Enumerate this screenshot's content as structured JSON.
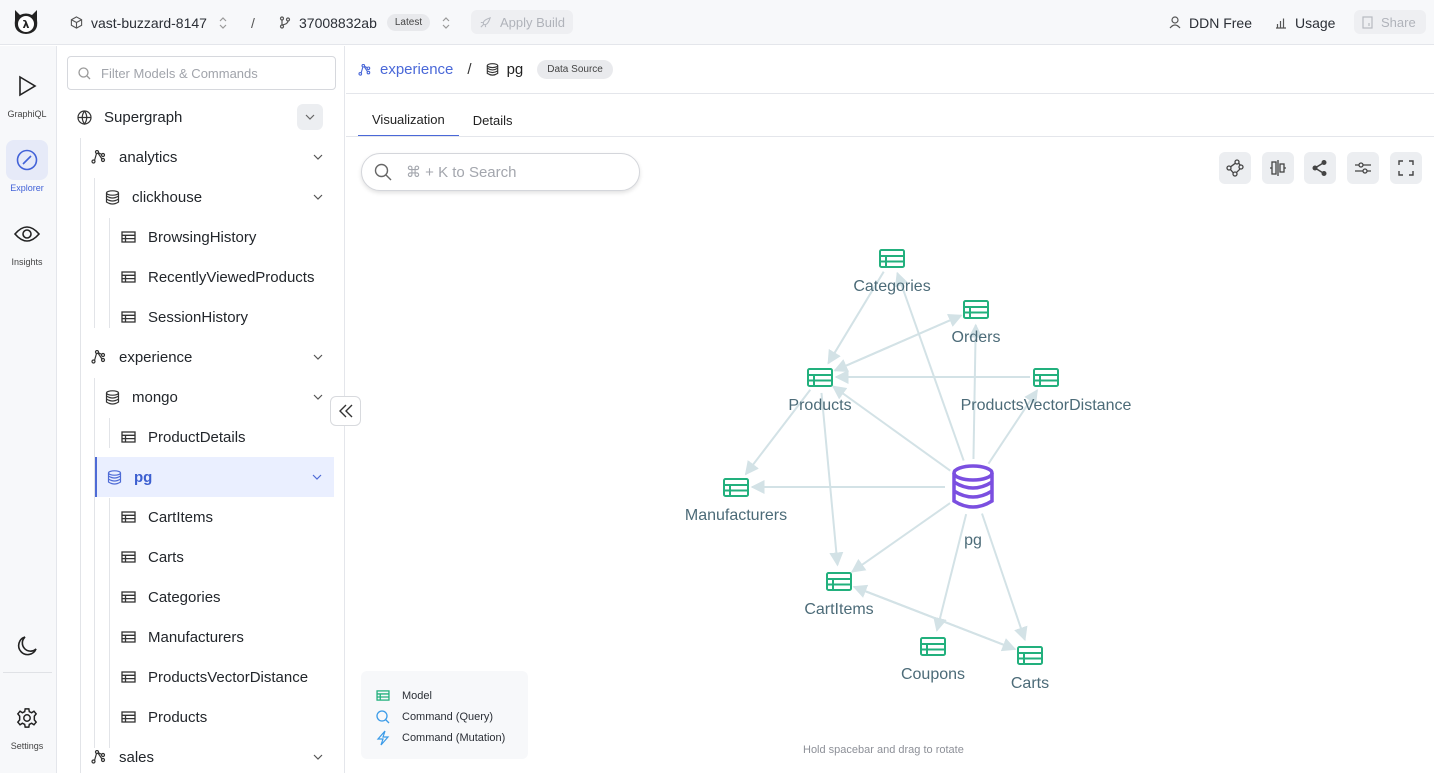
{
  "topbar": {
    "project": "vast-buzzard-8147",
    "separator": "/",
    "build_id": "37008832ab",
    "build_badge": "Latest",
    "apply_build": "Apply Build",
    "plan": "DDN Free",
    "usage": "Usage",
    "share": "Share"
  },
  "rail": {
    "items": [
      {
        "label": "GraphiQL",
        "icon": "play-icon"
      },
      {
        "label": "Explorer",
        "icon": "compass-icon",
        "active": true
      },
      {
        "label": "Insights",
        "icon": "eye-icon"
      }
    ],
    "theme_icon": "moon-icon",
    "settings": {
      "label": "Settings",
      "icon": "gear-icon"
    }
  },
  "tree": {
    "filter_placeholder": "Filter Models & Commands",
    "root": "Supergraph",
    "subgraphs": [
      {
        "name": "analytics",
        "sources": [
          {
            "name": "clickhouse",
            "models": [
              "BrowsingHistory",
              "RecentlyViewedProducts",
              "SessionHistory"
            ]
          }
        ]
      },
      {
        "name": "experience",
        "sources": [
          {
            "name": "mongo",
            "models": [
              "ProductDetails"
            ]
          },
          {
            "name": "pg",
            "selected": true,
            "models": [
              "CartItems",
              "Carts",
              "Categories",
              "Manufacturers",
              "ProductsVectorDistance",
              "Products"
            ]
          }
        ]
      },
      {
        "name": "sales",
        "sources": []
      }
    ]
  },
  "main": {
    "breadcrumb": {
      "subgraph": "experience",
      "separator": "/",
      "current": "pg",
      "badge": "Data Source"
    },
    "tabs": [
      {
        "label": "Visualization",
        "active": true
      },
      {
        "label": "Details"
      }
    ],
    "search_placeholder": "⌘ + K to Search",
    "toolbar": [
      "graph-layout-icon",
      "align-icon",
      "share-icon",
      "sliders-icon",
      "fullscreen-icon"
    ],
    "legend": [
      {
        "label": "Model",
        "icon": "table-icon",
        "color": "#22b07d"
      },
      {
        "label": "Command (Query)",
        "icon": "search-icon",
        "color": "#3b9be8"
      },
      {
        "label": "Command (Mutation)",
        "icon": "bolt-icon",
        "color": "#3b9be8"
      }
    ],
    "hint": "Hold spacebar and drag to rotate"
  },
  "graph": {
    "center": "pg",
    "nodes": [
      {
        "id": "Categories",
        "type": "model"
      },
      {
        "id": "Orders",
        "type": "model"
      },
      {
        "id": "Products",
        "type": "model"
      },
      {
        "id": "ProductsVectorDistance",
        "type": "model"
      },
      {
        "id": "Manufacturers",
        "type": "model"
      },
      {
        "id": "pg",
        "type": "datasource"
      },
      {
        "id": "CartItems",
        "type": "model"
      },
      {
        "id": "Coupons",
        "type": "model"
      },
      {
        "id": "Carts",
        "type": "model"
      }
    ],
    "edges": [
      {
        "from": "Categories",
        "to": "Products"
      },
      {
        "from": "Orders",
        "to": "Products"
      },
      {
        "from": "Products",
        "to": "Orders"
      },
      {
        "from": "ProductsVectorDistance",
        "to": "Products"
      },
      {
        "from": "pg",
        "to": "Products"
      },
      {
        "from": "pg",
        "to": "Categories"
      },
      {
        "from": "pg",
        "to": "Orders"
      },
      {
        "from": "pg",
        "to": "ProductsVectorDistance"
      },
      {
        "from": "Products",
        "to": "Manufacturers"
      },
      {
        "from": "pg",
        "to": "Manufacturers"
      },
      {
        "from": "Products",
        "to": "CartItems"
      },
      {
        "from": "pg",
        "to": "CartItems"
      },
      {
        "from": "pg",
        "to": "Coupons"
      },
      {
        "from": "pg",
        "to": "Carts"
      },
      {
        "from": "CartItems",
        "to": "Carts"
      },
      {
        "from": "Carts",
        "to": "CartItems"
      }
    ],
    "colors": {
      "model": "#22b07d",
      "datasource": "#7b4fe0",
      "edge": "#d3e2e6",
      "label": "#4c6b78"
    }
  }
}
